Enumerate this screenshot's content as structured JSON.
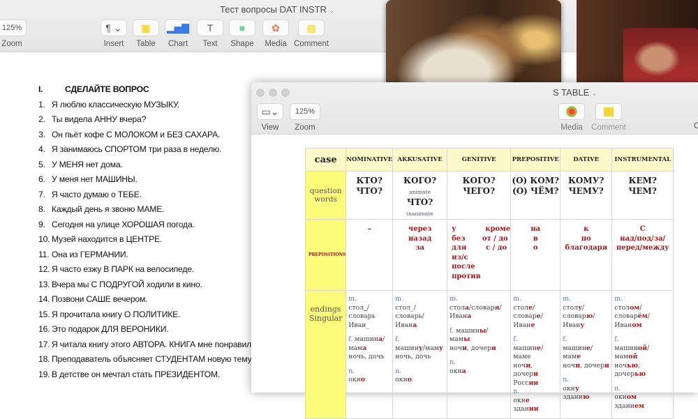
{
  "main_window": {
    "title": "Тест вопросы DAT INSTR",
    "zoom": {
      "value": "125%",
      "label": "Zoom"
    },
    "toolbar": [
      {
        "label": "Insert",
        "icon": "paragraph-icon"
      },
      {
        "label": "Table",
        "icon": "table-icon"
      },
      {
        "label": "Chart",
        "icon": "chart-icon"
      },
      {
        "label": "Text",
        "icon": "text-icon"
      },
      {
        "label": "Shape",
        "icon": "shape-icon"
      },
      {
        "label": "Media",
        "icon": "media-icon"
      },
      {
        "label": "Comment",
        "icon": "comment-icon"
      }
    ],
    "document": {
      "heading_num": "I.",
      "heading": "СДЕЛАЙТЕ ВОПРОС",
      "items": [
        "Я люблю классическую МУЗЫКУ.",
        "Ты видела АННУ вчера?",
        "Он пьёт кофе С МОЛОКОМ и БЕЗ САХАРА.",
        "Я занимаюсь СПОРТОМ три раза в неделю.",
        "У МЕНЯ нет дома.",
        "У меня нет МАШИНЫ.",
        "Я часто думаю о ТЕБЕ.",
        "Каждый день я звоню МАМЕ.",
        "Сегодня на улице ХОРОШАЯ погода.",
        "Музей находится в ЦЕНТРЕ.",
        "Она из ГЕРМАНИИ.",
        "Я часто езжу В ПАРК на велосипеде.",
        "Вчера мы С ПОДРУГОЙ ходили в кино.",
        "Позвони САШЕ вечером.",
        "Я прочитала книгу О ПОЛИТИКЕ.",
        "Это подарок ДЛЯ ВЕРОНИКИ.",
        "Я читала книгу этого АВТОРА. КНИГА мне понравилась.",
        "Преподаватель объясняет СТУДЕНТАМ новую тему.",
        "В детстве он мечтал стать ПРЕЗИДЕНТОМ."
      ]
    }
  },
  "second_window": {
    "title_partial": "S TABLE",
    "view_label": "View",
    "zoom": {
      "value": "125%",
      "label": "Zoom"
    },
    "media_label": "Media",
    "comment_label": "Comment",
    "cut_label": "C",
    "table": {
      "corner": "case",
      "columns": [
        "NOMINATIVE",
        "AKKUSATIVE",
        "GENITIVE",
        "PREPOSITIVE",
        "DATIVE",
        "INSTRUMENTAL"
      ],
      "row_labels": [
        "question words",
        "PREPOSITIONS",
        "endings Singular"
      ],
      "questions": [
        [
          "КТО?",
          "ЧТО?"
        ],
        [
          "КОГО?|animate",
          "ЧТО? |inanimate"
        ],
        [
          "КОГО?",
          "ЧЕГО?"
        ],
        [
          "(О) КОМ?",
          "(О) ЧЁМ?"
        ],
        [
          "КОМУ?",
          "ЧЕМУ?"
        ],
        [
          "КЕМ?",
          "ЧЕМ?"
        ]
      ],
      "prepositions": [
        [
          "–"
        ],
        [
          "через",
          "назад",
          "за"
        ],
        [
          "у            кроме",
          "без       от / до",
          "для        с / до",
          "из/с",
          "после",
          "против"
        ],
        [
          "на",
          "в",
          "о"
        ],
        [
          "к",
          "по",
          "благодаря"
        ],
        [
          "С",
          "над/под/за/",
          "перед/между"
        ]
      ],
      "endings": [
        [
          [
            [
              "m.",
              "g"
            ]
          ],
          [
            [
              "стол",
              ""
            ],
            [
              "_",
              "r"
            ],
            [
              "/",
              ""
            ]
          ],
          [
            [
              "словарь",
              ""
            ]
          ],
          [
            [
              "Иван_",
              ""
            ]
          ],
          "gap",
          [
            [
              "f. ",
              "g"
            ],
            [
              "машин",
              ""
            ],
            [
              "а",
              "r"
            ],
            [
              "/",
              ""
            ]
          ],
          [
            [
              "мам",
              ""
            ],
            [
              "а",
              "r"
            ]
          ],
          [
            [
              "ночь, дочь",
              ""
            ]
          ],
          "gap",
          [
            [
              "n.",
              "g"
            ]
          ],
          [
            [
              " окн",
              ""
            ],
            [
              "о",
              "r"
            ]
          ]
        ],
        [
          [
            [
              "m.",
              "g"
            ]
          ],
          [
            [
              "стол_/ словарь/",
              ""
            ]
          ],
          [
            [
              "Иван",
              ""
            ],
            [
              "а",
              "r"
            ]
          ],
          "gap",
          [
            [
              "f.",
              "g"
            ]
          ],
          [
            [
              "машин",
              ""
            ],
            [
              "у",
              "r"
            ],
            [
              "/мам",
              ""
            ],
            [
              "у",
              "r"
            ]
          ],
          [
            [
              "ночь, дочь",
              ""
            ]
          ],
          "gap",
          [
            [
              "n.",
              "g"
            ]
          ],
          [
            [
              "окн",
              ""
            ],
            [
              "о",
              "r"
            ]
          ]
        ],
        [
          [
            [
              "m.",
              "g"
            ]
          ],
          [
            [
              "стол",
              ""
            ],
            [
              "а",
              "r"
            ],
            [
              "/словар",
              ""
            ],
            [
              "я",
              "r"
            ],
            [
              "/",
              ""
            ]
          ],
          [
            [
              "Иван",
              ""
            ],
            [
              "а",
              "r"
            ]
          ],
          "gap",
          [
            [
              "f. ",
              "g"
            ],
            [
              "машин",
              ""
            ],
            [
              "ы",
              "r"
            ],
            [
              "/",
              ""
            ]
          ],
          [
            [
              "мам",
              ""
            ],
            [
              "ы",
              "r"
            ]
          ],
          [
            [
              "ноч",
              ""
            ],
            [
              "и",
              "r"
            ],
            [
              ", дочер",
              ""
            ],
            [
              "и",
              "r"
            ]
          ],
          "gap",
          [
            [
              "n.",
              "g"
            ]
          ],
          [
            [
              "окн",
              ""
            ],
            [
              "а",
              "r"
            ]
          ]
        ],
        [
          [
            [
              "m.",
              "g"
            ]
          ],
          [
            [
              "стол",
              ""
            ],
            [
              "е",
              "r"
            ],
            [
              "/",
              ""
            ]
          ],
          [
            [
              "словар",
              ""
            ],
            [
              "е",
              "r"
            ],
            [
              "/",
              ""
            ]
          ],
          [
            [
              "Иван",
              ""
            ],
            [
              "е",
              "r"
            ]
          ],
          "gap",
          [
            [
              "f.",
              "g"
            ]
          ],
          [
            [
              "машин",
              ""
            ],
            [
              "е",
              "r"
            ],
            [
              "/маме",
              ""
            ]
          ],
          [
            [
              "ноч",
              ""
            ],
            [
              "и",
              "r"
            ],
            [
              ", дочер",
              ""
            ],
            [
              "и",
              "r"
            ]
          ],
          [
            [
              "Росс",
              ""
            ],
            [
              "ии",
              "r"
            ]
          ],
          [
            [
              "n.",
              "g"
            ]
          ],
          [
            [
              "окн",
              ""
            ],
            [
              "е",
              "r"
            ]
          ],
          [
            [
              "здан",
              ""
            ],
            [
              "ии",
              "r"
            ]
          ]
        ],
        [
          [
            [
              "m.",
              "g"
            ]
          ],
          [
            [
              "стол",
              ""
            ],
            [
              "у",
              "r"
            ],
            [
              "/",
              ""
            ]
          ],
          [
            [
              "словар",
              ""
            ],
            [
              "ю",
              "r"
            ],
            [
              "/",
              ""
            ]
          ],
          [
            [
              "Иван",
              ""
            ],
            [
              "у",
              "r"
            ]
          ],
          "gap",
          [
            [
              "f.",
              "g"
            ]
          ],
          [
            [
              "машин",
              ""
            ],
            [
              "е",
              "r"
            ],
            [
              "/мам",
              ""
            ],
            [
              "е",
              "r"
            ]
          ],
          [
            [
              "ноч",
              ""
            ],
            [
              "и",
              "r"
            ],
            [
              ", дочер",
              ""
            ],
            [
              "и",
              "r"
            ]
          ],
          "gap",
          [
            [
              "n.",
              "g"
            ]
          ],
          [
            [
              "окн",
              ""
            ],
            [
              "у",
              "r"
            ]
          ],
          [
            [
              "здани",
              ""
            ],
            [
              "ю",
              "r"
            ]
          ]
        ],
        [
          [
            [
              "m.",
              "g"
            ]
          ],
          [
            [
              "стол",
              ""
            ],
            [
              "ом",
              "r"
            ],
            [
              "/словар",
              ""
            ],
            [
              "ём",
              "r"
            ],
            [
              "/",
              ""
            ]
          ],
          [
            [
              "Иван",
              ""
            ],
            [
              "ом",
              "r"
            ]
          ],
          "gap",
          [
            [
              "f.",
              "g"
            ]
          ],
          [
            [
              "машин",
              ""
            ],
            [
              "ой",
              "r"
            ],
            [
              "/мам",
              ""
            ],
            [
              "ой",
              "r"
            ]
          ],
          [
            [
              "ноч",
              ""
            ],
            [
              "ью",
              "r"
            ],
            [
              ", дочер",
              ""
            ],
            [
              "ью",
              "r"
            ]
          ],
          "gap",
          [
            [
              "n.",
              "g"
            ]
          ],
          [
            [
              "окн",
              ""
            ],
            [
              "ом",
              "r"
            ]
          ],
          [
            [
              "здани",
              ""
            ],
            [
              "ем",
              "r"
            ]
          ]
        ]
      ]
    }
  },
  "colors": {
    "header_bg": "#fcf9c8",
    "side_bg": "#fdfb7a",
    "emphasis": "#b01818",
    "gender": "#5577bb"
  }
}
